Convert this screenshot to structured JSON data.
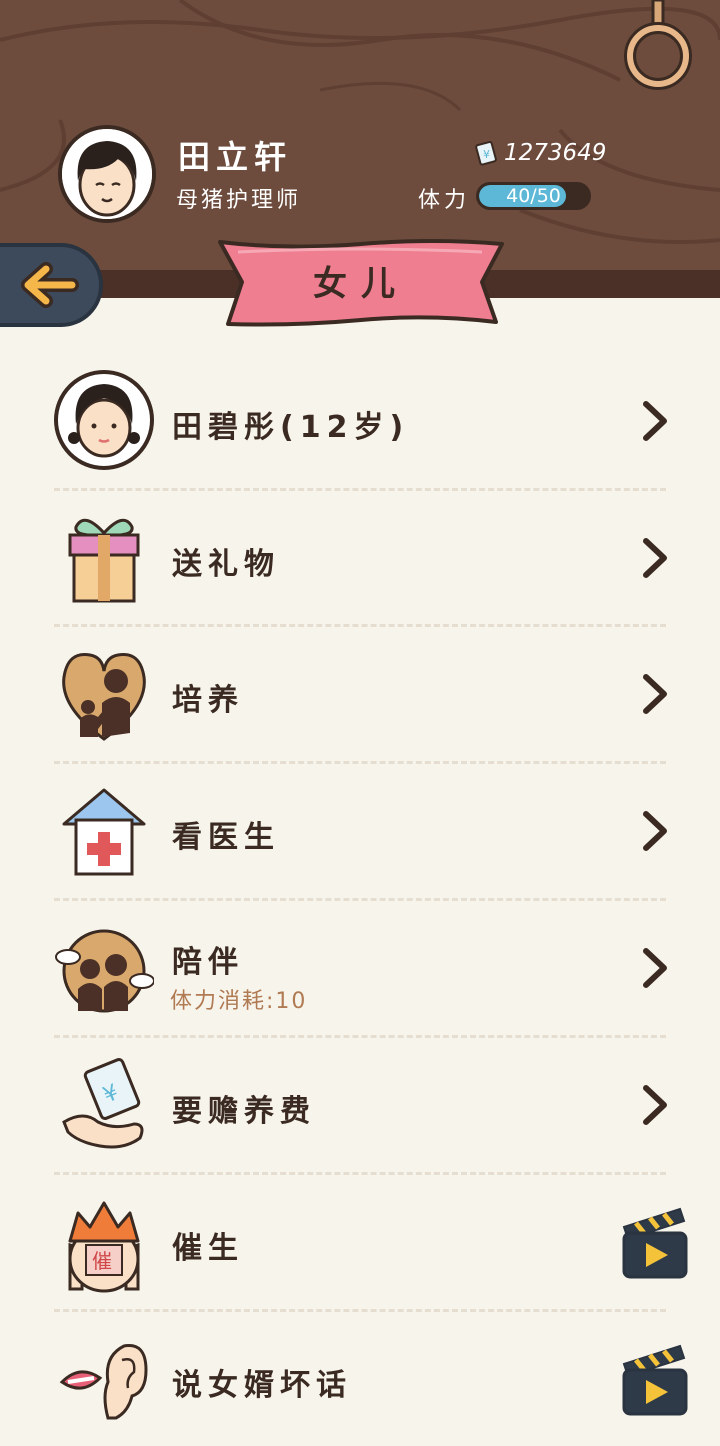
{
  "user": {
    "name": "田立轩",
    "title": "母猪护理师",
    "money": "1273649",
    "stamina_label": "体力",
    "stamina_text": "40/50",
    "stamina_fraction": 0.8
  },
  "page": {
    "title": "女儿",
    "back_icon": "arrow-left-icon"
  },
  "colors": {
    "header_wood": "#6d4c3d",
    "banner_pink": "#ef7e90",
    "stamina_fill": "#5cb8d6",
    "background": "#f7f4ec",
    "text_dark": "#3a2a22",
    "cost_text": "#b07a52"
  },
  "menu": [
    {
      "label": "田碧彤(12岁)",
      "icon": "daughter-avatar-icon",
      "action": "chevron"
    },
    {
      "label": "送礼物",
      "icon": "gift-box-icon",
      "action": "chevron"
    },
    {
      "label": "培养",
      "icon": "heart-parent-child-icon",
      "action": "chevron"
    },
    {
      "label": "看医生",
      "icon": "hospital-icon",
      "action": "chevron"
    },
    {
      "label": "陪伴",
      "sub": "体力消耗:10",
      "icon": "companion-icon",
      "action": "chevron"
    },
    {
      "label": "要赡养费",
      "icon": "money-hand-icon",
      "action": "chevron"
    },
    {
      "label": "催生",
      "icon": "urge-birth-icon",
      "action": "video"
    },
    {
      "label": "说女婿坏话",
      "icon": "gossip-ear-icon",
      "action": "video"
    }
  ]
}
